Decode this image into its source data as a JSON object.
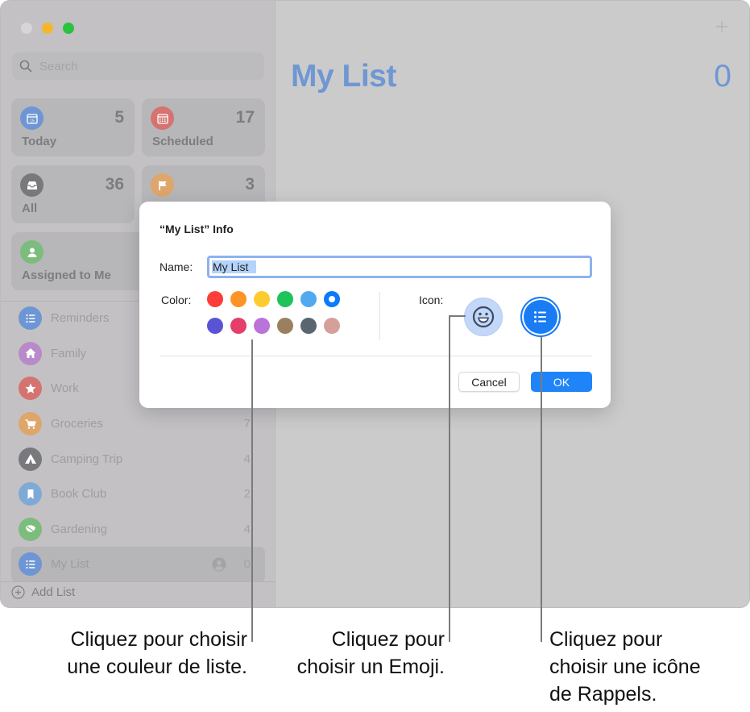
{
  "window": {
    "traffic_lights": [
      "close",
      "minimize",
      "maximize"
    ]
  },
  "sidebar": {
    "search_placeholder": "Search",
    "smart_lists": [
      {
        "label": "Today",
        "count": "5",
        "icon": "calendar-today-icon",
        "color": "#6e96d4"
      },
      {
        "label": "Scheduled",
        "count": "17",
        "icon": "calendar-scheduled-icon",
        "color": "#d57370"
      },
      {
        "label": "All",
        "count": "36",
        "icon": "tray-icon",
        "color": "#79787c"
      },
      {
        "label": "Flagged",
        "count": "3",
        "icon": "flag-icon",
        "color": "#dea66b"
      },
      {
        "label": "Assigned to Me",
        "count": "",
        "icon": "person-icon",
        "color": "#7cbc7d"
      }
    ],
    "lists": [
      {
        "name": "Reminders",
        "count": "",
        "icon": "list-icon",
        "color": "#6e96d4"
      },
      {
        "name": "Family",
        "count": "",
        "icon": "house-icon",
        "color": "#b88ac9"
      },
      {
        "name": "Work",
        "count": "",
        "icon": "star-icon",
        "color": "#d57370"
      },
      {
        "name": "Groceries",
        "count": "7",
        "icon": "cart-icon",
        "color": "#dea66b"
      },
      {
        "name": "Camping Trip",
        "count": "4",
        "icon": "tent-icon",
        "color": "#79787c"
      },
      {
        "name": "Book Club",
        "count": "2",
        "icon": "bookmark-icon",
        "color": "#80aad6"
      },
      {
        "name": "Gardening",
        "count": "4",
        "icon": "leaf-icon",
        "color": "#7cbc7d"
      },
      {
        "name": "My List",
        "count": "0",
        "icon": "list-icon",
        "color": "#6e96d4",
        "selected": true,
        "shared": true
      }
    ],
    "add_list_label": "Add List"
  },
  "main": {
    "title": "My List",
    "count": "0",
    "accent_color": "#6f97d2"
  },
  "dialog": {
    "title": "“My List” Info",
    "name_label": "Name:",
    "name_value": "My List",
    "color_label": "Color:",
    "colors": [
      {
        "name": "red",
        "hex": "#fc3d39"
      },
      {
        "name": "orange",
        "hex": "#fd9426"
      },
      {
        "name": "yellow",
        "hex": "#fecb2e"
      },
      {
        "name": "green",
        "hex": "#1ec35a"
      },
      {
        "name": "light-blue",
        "hex": "#52a9f0"
      },
      {
        "name": "blue",
        "hex": "#0a7bfb",
        "selected": true
      },
      {
        "name": "indigo",
        "hex": "#5a54d4"
      },
      {
        "name": "pink",
        "hex": "#e53e6b"
      },
      {
        "name": "purple",
        "hex": "#ba73da"
      },
      {
        "name": "brown",
        "hex": "#9b805f"
      },
      {
        "name": "dark-gray",
        "hex": "#5b656f"
      },
      {
        "name": "rose",
        "hex": "#d5a09a"
      }
    ],
    "icon_label": "Icon:",
    "cancel_label": "Cancel",
    "ok_label": "OK"
  },
  "callouts": [
    {
      "text_lines": [
        "Cliquez pour choisir",
        "une couleur de liste."
      ]
    },
    {
      "text_lines": [
        "Cliquez pour",
        "choisir un Emoji."
      ]
    },
    {
      "text_lines": [
        "Cliquez pour",
        "choisir une icône",
        "de Rappels."
      ]
    }
  ]
}
